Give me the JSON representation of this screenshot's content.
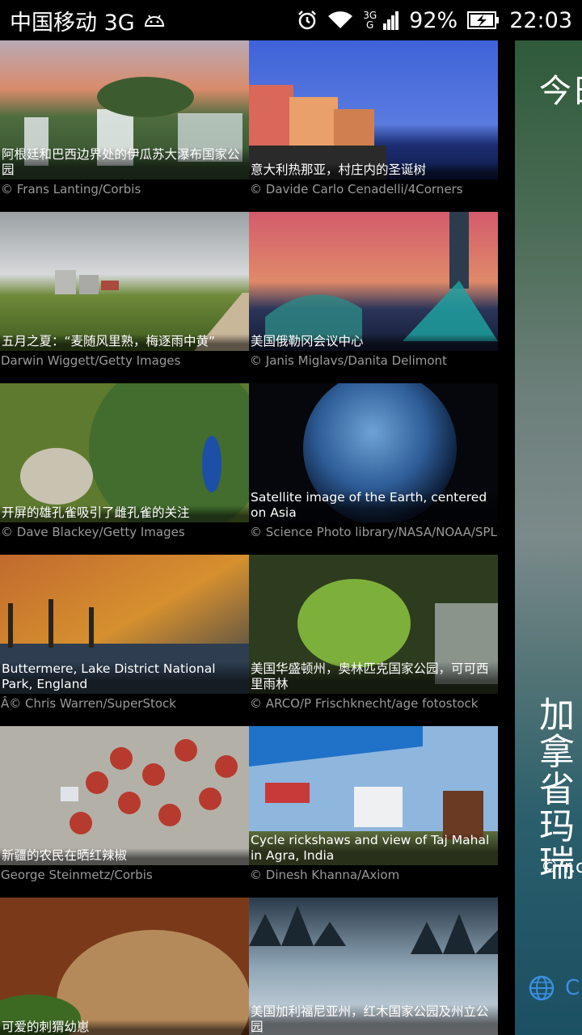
{
  "status_bar": {
    "carrier": "中国移动 3G",
    "network_badge_top": "3G",
    "network_badge_bottom": "G",
    "battery": "92%",
    "time": "22:03"
  },
  "tiles": [
    {
      "caption": "阿根廷和巴西边界处的伊瓜苏大瀑布国家公园",
      "credit": "© Frans Lanting/Corbis"
    },
    {
      "caption": "意大利热那亚，村庄内的圣诞树",
      "credit": "© Davide Carlo Cenadelli/4Corners"
    },
    {
      "caption": "五月之夏：“麦随风里熟，梅逐雨中黄”",
      "credit": "Darwin Wiggett/Getty Images"
    },
    {
      "caption": "美国俄勒冈会议中心",
      "credit": "© Janis Miglavs/Danita Delimont"
    },
    {
      "caption": "开屏的雄孔雀吸引了雌孔雀的关注",
      "credit": "© Dave Blackey/Getty Images"
    },
    {
      "caption": "Satellite image of the Earth, centered on Asia",
      "credit": "© Science Photo library/NASA/NOAA/SPL"
    },
    {
      "caption": "Buttermere, Lake District National Park, England",
      "credit": "Â© Chris Warren/SuperStock"
    },
    {
      "caption": "美国华盛顿州，奥林匹克国家公园，可可西里雨林",
      "credit": "© ARCO/P Frischknecht/age fotostock"
    },
    {
      "caption": "新疆的农民在晒红辣椒",
      "credit": "George Steinmetz/Corbis"
    },
    {
      "caption": "Cycle rickshaws and view of Taj Mahal in Agra, India",
      "credit": "© Dinesh Khanna/Axiom"
    },
    {
      "caption": "可爱的刺猬幼崽",
      "credit": ""
    },
    {
      "caption": "美国加利福尼亚州，红木国家公园及州立公园",
      "credit": ""
    }
  ],
  "drawer": {
    "title": "今日",
    "big_text": "加拿\n省\n玛瑞",
    "credit": "© r.c",
    "link": "C"
  }
}
